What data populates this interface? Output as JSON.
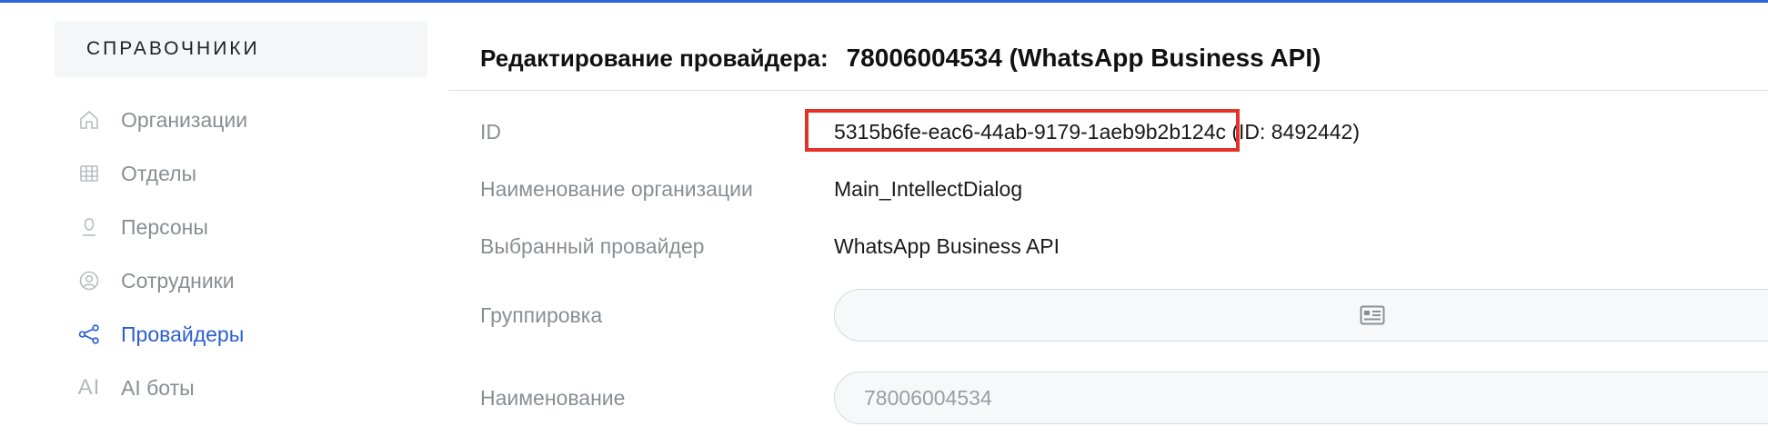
{
  "colors": {
    "accent": "#2b5fd1",
    "highlight": "#e53127",
    "top_line": "#2f62d8"
  },
  "sidebar": {
    "header": "СПРАВОЧНИКИ",
    "items": [
      {
        "label": "Организации",
        "icon": "home-icon",
        "active": false
      },
      {
        "label": "Отделы",
        "icon": "grid-icon",
        "active": false
      },
      {
        "label": "Персоны",
        "icon": "person-icon",
        "active": false
      },
      {
        "label": "Сотрудники",
        "icon": "user-circle-icon",
        "active": false
      },
      {
        "label": "Провайдеры",
        "icon": "share-icon",
        "active": true
      },
      {
        "label": "AI боты",
        "icon": "ai-icon",
        "icon_text": "AI",
        "active": false
      }
    ]
  },
  "main": {
    "title_label": "Редактирование провайдера:",
    "title_value": "78006004534 (WhatsApp Business API)",
    "fields": {
      "id": {
        "label": "ID",
        "value": "5315b6fe-eac6-44ab-9179-1aeb9b2b124c (ID: 8492442)"
      },
      "organization": {
        "label": "Наименование организации",
        "value": "Main_IntellectDialog"
      },
      "provider": {
        "label": "Выбранный провайдер",
        "value": "WhatsApp Business API"
      },
      "grouping": {
        "label": "Группировка",
        "value": "",
        "icon": "card-icon"
      },
      "name": {
        "label": "Наименование",
        "placeholder": "78006004534"
      }
    }
  }
}
